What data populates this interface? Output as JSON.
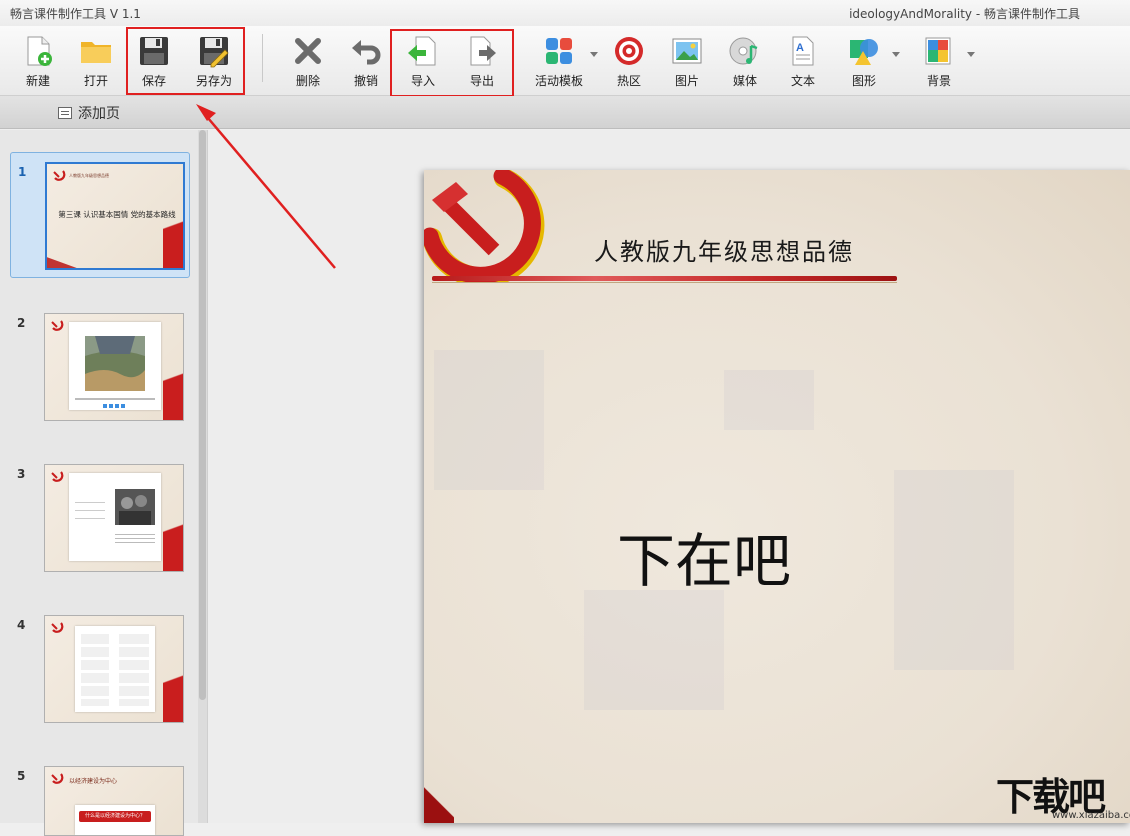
{
  "window": {
    "app_title": "畅言课件制作工具 V 1.1",
    "doc_title": "ideologyAndMorality - 畅言课件制作工具"
  },
  "toolbar": {
    "new_label": "新建",
    "open_label": "打开",
    "save_label": "保存",
    "save_as_label": "另存为",
    "delete_label": "删除",
    "undo_label": "撤销",
    "import_label": "导入",
    "export_label": "导出",
    "template_label": "活动模板",
    "hotspot_label": "热区",
    "image_label": "图片",
    "media_label": "媒体",
    "text_label": "文本",
    "shape_label": "图形",
    "background_label": "背景"
  },
  "subbar": {
    "add_page_label": "添加页"
  },
  "thumbnails": [
    {
      "num": "1",
      "head": "人教版九年级思想品德",
      "title": "第三课 认识基本国情 党的基本路线"
    },
    {
      "num": "2"
    },
    {
      "num": "3"
    },
    {
      "num": "4"
    },
    {
      "num": "5",
      "head": "以经济建设为中心",
      "card_text": "什么是以经济建设为中心？"
    }
  ],
  "slide": {
    "header": "人教版九年级思想品德",
    "body_text": "下在吧"
  },
  "watermark": {
    "big": "下载吧",
    "small": "www.xiazaiba.com"
  },
  "colors": {
    "accent_red": "#e02020",
    "selection_blue": "#2f7ad2",
    "party_red": "#c81e1e",
    "gold": "#e6b800"
  }
}
